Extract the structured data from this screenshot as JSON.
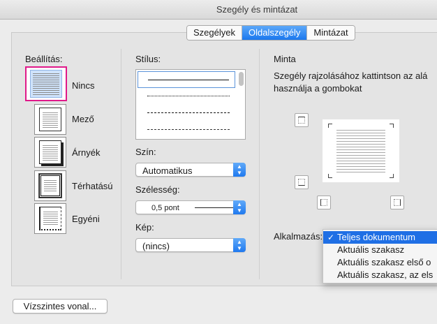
{
  "window": {
    "title": "Szegély és mintázat"
  },
  "tabs": [
    {
      "label": "Szegélyek",
      "active": false
    },
    {
      "label": "Oldalszegély",
      "active": true
    },
    {
      "label": "Mintázat",
      "active": false
    }
  ],
  "settings": {
    "heading": "Beállítás:",
    "items": [
      {
        "label": "Nincs",
        "selected": true
      },
      {
        "label": "Mező",
        "selected": false
      },
      {
        "label": "Árnyék",
        "selected": false
      },
      {
        "label": "Térhatású",
        "selected": false
      },
      {
        "label": "Egyéni",
        "selected": false
      }
    ]
  },
  "style": {
    "heading": "Stílus:",
    "options": [
      "solid",
      "dotted",
      "dashed",
      "long-dashed"
    ]
  },
  "color": {
    "heading": "Szín:",
    "value": "Automatikus"
  },
  "width": {
    "heading": "Szélesség:",
    "value": "0,5 pont"
  },
  "art": {
    "heading": "Kép:",
    "value": "(nincs)"
  },
  "preview": {
    "heading": "Minta",
    "instructions_line1": "Szegély rajzolásához kattintson az alá",
    "instructions_line2": "használja a gombokat"
  },
  "apply": {
    "label": "Alkalmazás:",
    "options": [
      {
        "label": "Teljes dokumentum",
        "selected": true
      },
      {
        "label": "Aktuális szakasz",
        "selected": false
      },
      {
        "label": "Aktuális szakasz első o",
        "selected": false
      },
      {
        "label": "Aktuális szakasz, az els",
        "selected": false
      }
    ]
  },
  "footer": {
    "horizontal_line_button": "Vízszintes vonal..."
  },
  "colors": {
    "accent": "#1b78ee",
    "selection_highlight": "#e0198a",
    "menu_selected": "#1f6fe5"
  }
}
